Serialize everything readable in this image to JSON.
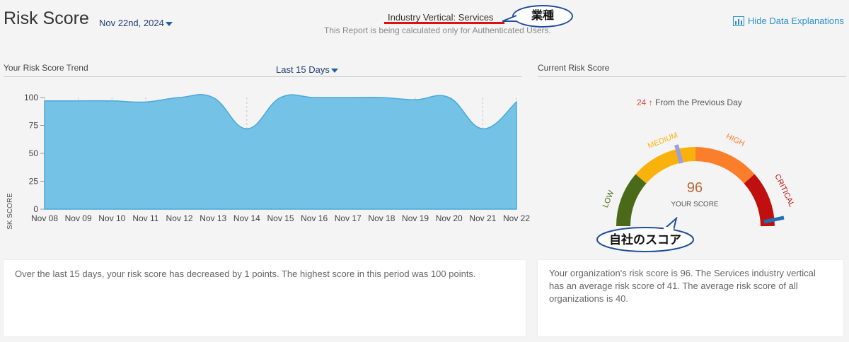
{
  "header": {
    "title": "Risk Score",
    "date": "Nov 22nd, 2024",
    "industry_label": "Industry Vertical: Services",
    "report_note": "This Report is being calculated only for Authenticated Users.",
    "hide_explanations": "Hide Data Explanations",
    "callout_industry": "業種"
  },
  "trend": {
    "section_title": "Your Risk Score Trend",
    "range_label": "Last 15 Days",
    "explanation": "Over the last 15 days, your risk score has decreased by 1 points. The highest score in this period was 100 points."
  },
  "current": {
    "section_title": "Current Risk Score",
    "change_value": "24",
    "change_arrow": "↑",
    "change_text": "From the Previous Day",
    "score": "96",
    "score_label": "YOUR SCORE",
    "callout_score": "自社のスコア",
    "gauge_labels": [
      "LOW",
      "MEDIUM",
      "HIGH",
      "CRITICAL"
    ],
    "explanation": "Your organization's risk score is 96. The Services industry vertical has an average risk score of 41. The average risk score of all organizations is 40."
  },
  "colors": {
    "area_fill": "#74c2e5",
    "area_stroke": "#4aa8da",
    "low": "#4a6a1a",
    "medium": "#f9b20c",
    "high": "#fb7f2a",
    "critical": "#c00f0f"
  },
  "chart_data": {
    "type": "area",
    "title": "",
    "xlabel": "",
    "ylabel": "RISK SCORE",
    "ylim": [
      0,
      100
    ],
    "yticks": [
      0,
      25,
      50,
      75,
      100
    ],
    "x": [
      "Nov 08",
      "Nov 09",
      "Nov 10",
      "Nov 11",
      "Nov 12",
      "Nov 13",
      "Nov 14",
      "Nov 15",
      "Nov 16",
      "Nov 17",
      "Nov 18",
      "Nov 19",
      "Nov 20",
      "Nov 21",
      "Nov 22"
    ],
    "series": [
      {
        "values": [
          97,
          97,
          97,
          96,
          100,
          100,
          72,
          100,
          100,
          100,
          100,
          98,
          100,
          72,
          96
        ]
      }
    ]
  }
}
